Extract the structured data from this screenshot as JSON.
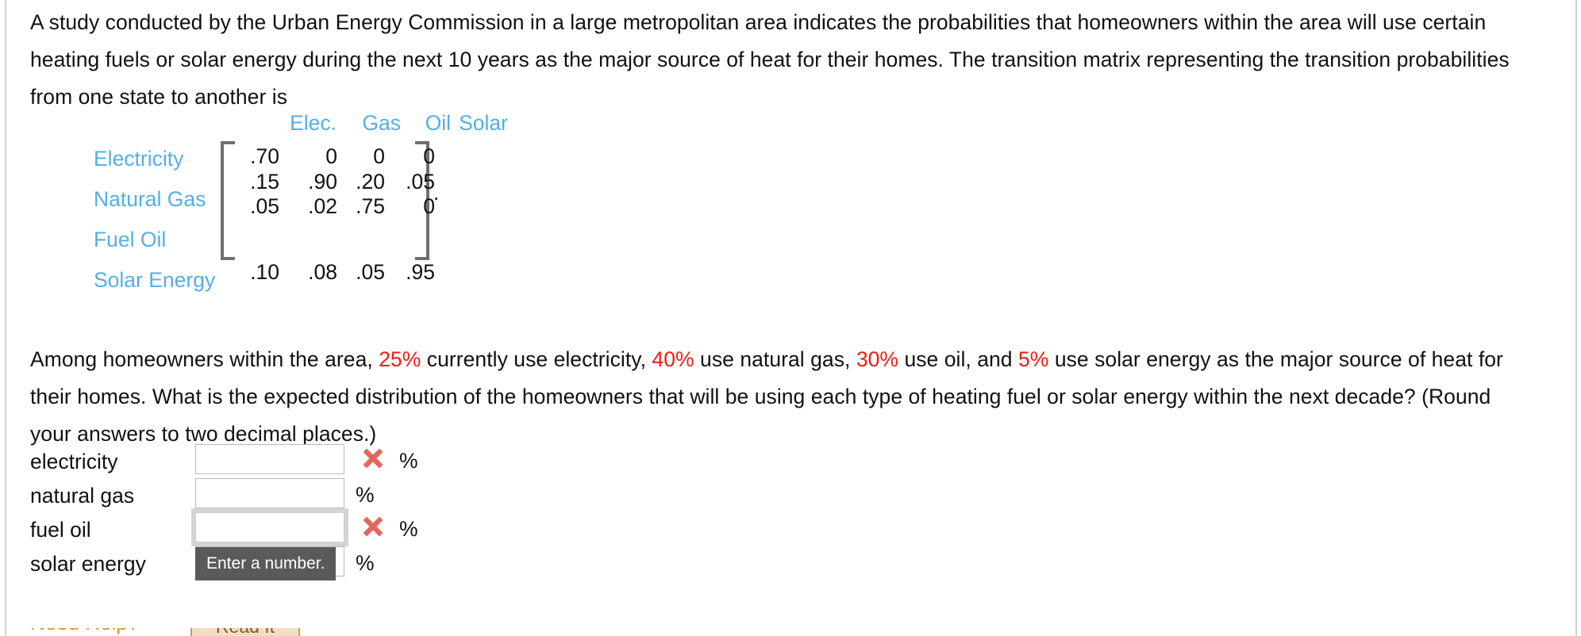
{
  "problem": {
    "intro_parts": [
      {
        "text": "A study conducted by the Urban Energy Commission in a large metropolitan area indicates the probabilities that homeowners within the area will use certain heating fuels or solar energy during the next 10 years as the major source of heat for their homes. The transition matrix representing the transition probabilities from one state to another is",
        "style": "plain"
      }
    ],
    "intro_text": "A study conducted by the Urban Energy Commission in a large metropolitan area indicates the probabilities that homeowners within the area will use certain heating fuels or solar energy during the next 10 years as the major source of heat for their homes. The transition matrix representing the transition probabilities from one state to another is",
    "question_segments": [
      {
        "text": "Among homeowners within the area, ",
        "highlight": false
      },
      {
        "text": "25%",
        "highlight": true
      },
      {
        "text": " currently use electricity, ",
        "highlight": false
      },
      {
        "text": "40%",
        "highlight": true
      },
      {
        "text": " use natural gas, ",
        "highlight": false
      },
      {
        "text": "30%",
        "highlight": true
      },
      {
        "text": " use oil, and ",
        "highlight": false
      },
      {
        "text": "5%",
        "highlight": true
      },
      {
        "text": " use solar energy as the major source of heat for their homes. What is the expected distribution of the homeowners that will be using each type of heating fuel or solar energy within the next decade? (Round your answers to two decimal places.)",
        "highlight": false
      }
    ],
    "trailing_period": "."
  },
  "matrix": {
    "column_headers": [
      "Elec.",
      "Gas",
      "Oil",
      "Solar"
    ],
    "row_labels": [
      "Electricity",
      "Natural Gas",
      "Fuel Oil",
      "Solar Energy"
    ],
    "values": [
      [
        ".70",
        "0",
        "0",
        "0"
      ],
      [
        ".15",
        ".90",
        ".20",
        ".05"
      ],
      [
        ".05",
        ".02",
        ".75",
        "0"
      ],
      [
        ".10",
        ".08",
        ".05",
        ".95"
      ]
    ],
    "label_color": "#55AEE8",
    "bracket_color": "#6f6f6f"
  },
  "answers": {
    "rows": [
      {
        "label": "electricity",
        "value": "",
        "unit": "%",
        "status": "incorrect",
        "focused": false
      },
      {
        "label": "natural gas",
        "value": "",
        "unit": "%",
        "status": "none",
        "focused": false
      },
      {
        "label": "fuel oil",
        "value": "",
        "unit": "%",
        "status": "incorrect",
        "focused": true
      },
      {
        "label": "solar energy",
        "value": "",
        "unit": "%",
        "status": "none",
        "focused": false
      }
    ],
    "tooltip": "Enter a number.",
    "incorrect_icon_color": "#e2675f"
  },
  "footer": {
    "need_help_label": "Need Help?",
    "read_it_label": "Read It"
  },
  "colors": {
    "highlight_red": "#f01c12",
    "link_blue": "#55AEE8",
    "tooltip_bg": "#5a5a5a",
    "rail_gray": "#d2d2d2"
  }
}
